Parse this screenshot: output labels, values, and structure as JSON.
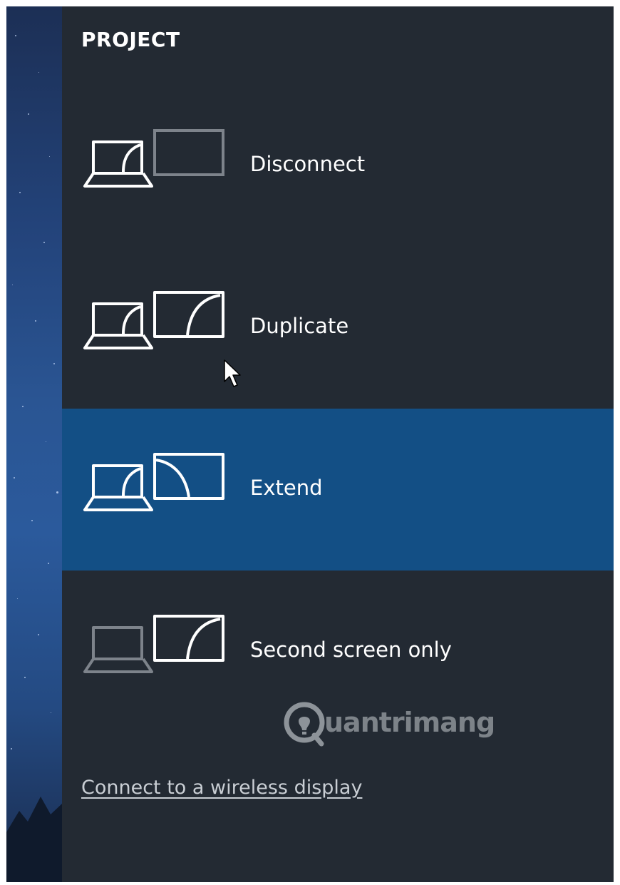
{
  "panel": {
    "title": "PROJECT"
  },
  "options": [
    {
      "label": "Disconnect",
      "icon": "disconnect-icon",
      "selected": false
    },
    {
      "label": "Duplicate",
      "icon": "duplicate-icon",
      "selected": false
    },
    {
      "label": "Extend",
      "icon": "extend-icon",
      "selected": true
    },
    {
      "label": "Second screen only",
      "icon": "second-screen-only-icon",
      "selected": false
    }
  ],
  "watermark": {
    "text": "uantrimang"
  },
  "wireless_link": {
    "label": "Connect to a wireless display"
  },
  "colors": {
    "panel_bg": "#232a33",
    "selected_bg": "#134f85",
    "text": "#ffffff",
    "link_text": "#c9ced4"
  }
}
